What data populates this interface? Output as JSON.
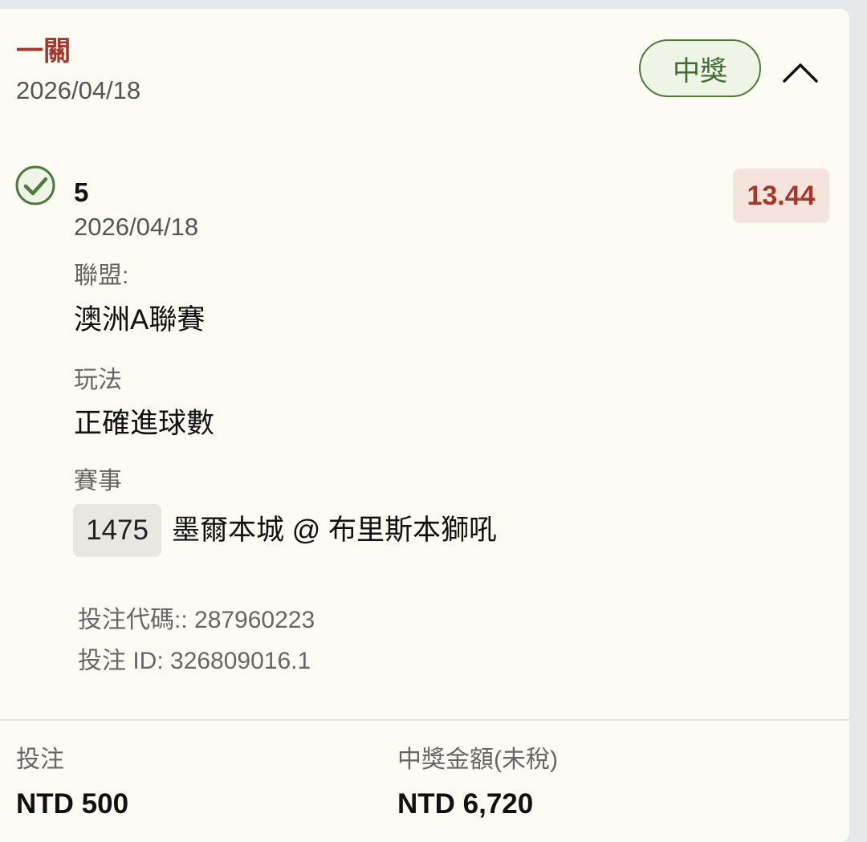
{
  "bet": {
    "type_label": "一關",
    "date": "2026/04/18",
    "status": "中獎"
  },
  "selection": {
    "title": "5",
    "date": "2026/04/18",
    "odds": "13.44",
    "league_label": "聯盟:",
    "league_value": "澳洲A聯賽",
    "market_label": "玩法",
    "market_value": "正確進球數",
    "event_label": "賽事",
    "event_id": "1475",
    "event_name": "墨爾本城 @ 布里斯本獅吼"
  },
  "codes": {
    "bet_code": "投注代碼:: 287960223",
    "bet_id": "投注 ID: 326809016.1"
  },
  "footer": {
    "stake_label": "投注",
    "stake_value": "NTD 500",
    "payout_label": "中獎金額(未稅)",
    "payout_value": "NTD 6,720"
  },
  "colors": {
    "accent_red": "#a8352a",
    "win_green": "#4e7a3a",
    "card_bg": "#fcfbf4"
  },
  "icons": {
    "collapse": "chevron-up-icon",
    "status": "check-circle-icon"
  }
}
